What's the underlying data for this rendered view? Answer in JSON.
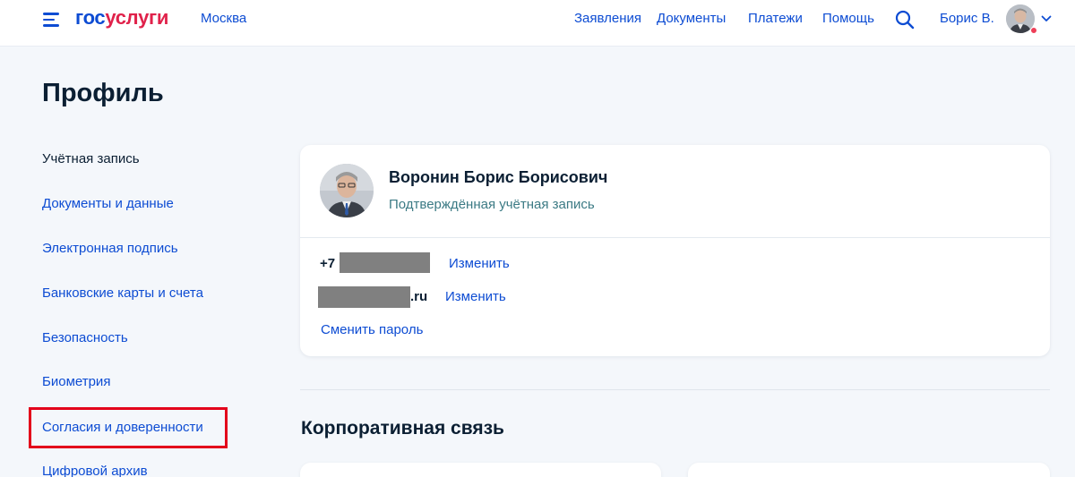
{
  "header": {
    "logo_part1": "гос",
    "logo_part2": "услуги",
    "city": "Москва",
    "nav": [
      {
        "label": "Заявления"
      },
      {
        "label": "Документы"
      },
      {
        "label": "Платежи"
      },
      {
        "label": "Помощь"
      }
    ],
    "user_name": "Борис В."
  },
  "page": {
    "title": "Профиль"
  },
  "sidebar": {
    "items": [
      {
        "label": "Учётная запись",
        "active": true
      },
      {
        "label": "Документы и данные"
      },
      {
        "label": "Электронная подпись"
      },
      {
        "label": "Банковские карты и счета"
      },
      {
        "label": "Безопасность"
      },
      {
        "label": "Биометрия"
      },
      {
        "label": "Согласия и доверенности",
        "highlighted": true
      },
      {
        "label": "Цифровой архив"
      }
    ]
  },
  "profile": {
    "full_name": "Воронин Борис Борисович",
    "status": "Подтверждённая учётная запись",
    "phone_prefix": "+7",
    "email_suffix": ".ru",
    "change_label": "Изменить",
    "change_password_label": "Сменить пароль"
  },
  "corporate": {
    "title": "Корпоративная связь"
  },
  "colors": {
    "brand_blue": "#0d4cd3",
    "brand_red": "#e0224b",
    "highlight_red": "#e3001b",
    "status_teal": "#3b7a84"
  }
}
